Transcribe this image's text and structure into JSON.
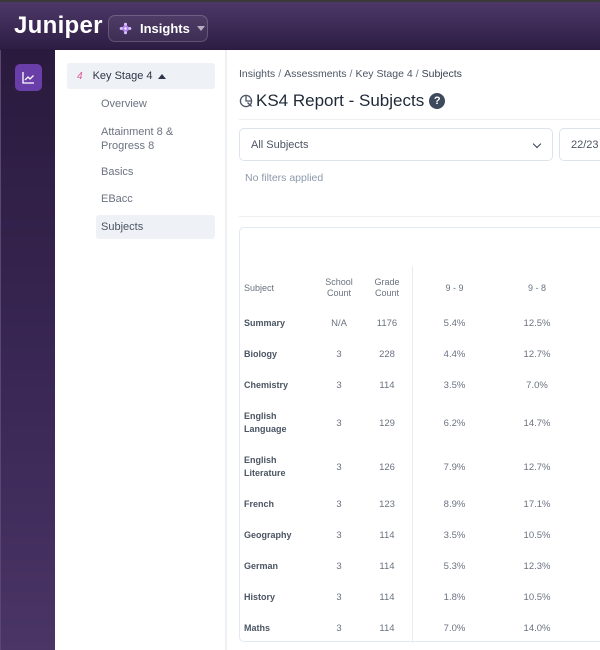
{
  "header": {
    "logo": "Juniper",
    "product": "Insights",
    "colors": {
      "bar_top": "#4d3868",
      "bar_bottom": "#2d1d44",
      "accent": "#6a3ea8",
      "diamond": "#b07ef0"
    }
  },
  "rail": {
    "items": [
      {
        "icon": "chart-line-icon",
        "active": true
      }
    ]
  },
  "subnav": {
    "parent": {
      "number": "4",
      "label": "Key Stage 4",
      "expanded": true
    },
    "items": [
      {
        "label": "Overview",
        "active": false
      },
      {
        "label": "Attainment 8 & Progress 8",
        "active": false
      },
      {
        "label": "Basics",
        "active": false
      },
      {
        "label": "EBacc",
        "active": false
      },
      {
        "label": "Subjects",
        "active": true
      }
    ]
  },
  "breadcrumb": {
    "items": [
      "Insights",
      "Assessments",
      "Key Stage 4",
      "Subjects"
    ],
    "separator": "/"
  },
  "page": {
    "title": "KS4 Report - Subjects",
    "help": "?"
  },
  "filters": {
    "subject_select": {
      "value": "All Subjects"
    },
    "year_select": {
      "value": "22/23"
    },
    "status": "No filters applied"
  },
  "table": {
    "columns": [
      "Subject",
      "School Count",
      "Grade Count",
      "9 - 9",
      "9 - 8"
    ],
    "rows": [
      {
        "subject": "Summary",
        "school_count": "N/A",
        "grade_count": "1176",
        "g99": "5.4%",
        "g98": "12.5%"
      },
      {
        "subject": "Biology",
        "school_count": "3",
        "grade_count": "228",
        "g99": "4.4%",
        "g98": "12.7%"
      },
      {
        "subject": "Chemistry",
        "school_count": "3",
        "grade_count": "114",
        "g99": "3.5%",
        "g98": "7.0%"
      },
      {
        "subject": "English Language",
        "school_count": "3",
        "grade_count": "129",
        "g99": "6.2%",
        "g98": "14.7%"
      },
      {
        "subject": "English Literature",
        "school_count": "3",
        "grade_count": "126",
        "g99": "7.9%",
        "g98": "12.7%"
      },
      {
        "subject": "French",
        "school_count": "3",
        "grade_count": "123",
        "g99": "8.9%",
        "g98": "17.1%"
      },
      {
        "subject": "Geography",
        "school_count": "3",
        "grade_count": "114",
        "g99": "3.5%",
        "g98": "10.5%"
      },
      {
        "subject": "German",
        "school_count": "3",
        "grade_count": "114",
        "g99": "5.3%",
        "g98": "12.3%"
      },
      {
        "subject": "History",
        "school_count": "3",
        "grade_count": "114",
        "g99": "1.8%",
        "g98": "10.5%"
      },
      {
        "subject": "Maths",
        "school_count": "3",
        "grade_count": "114",
        "g99": "7.0%",
        "g98": "14.0%"
      }
    ]
  }
}
